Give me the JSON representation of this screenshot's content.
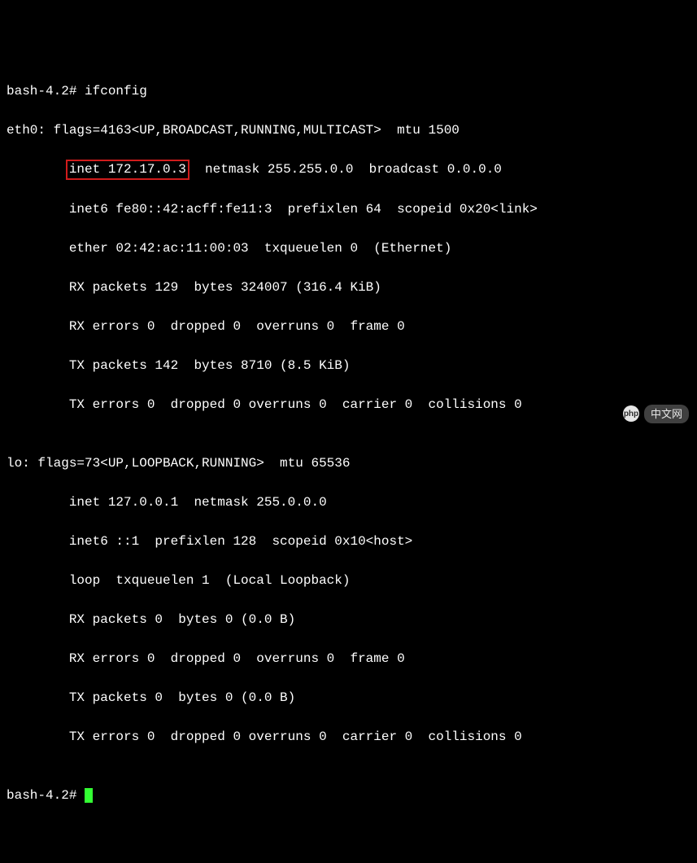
{
  "prompt1": "bash-4.2# ",
  "command": "ifconfig",
  "eth0": {
    "header": "eth0: flags=4163<UP,BROADCAST,RUNNING,MULTICAST>  mtu 1500",
    "inet_highlight": "inet 172.17.0.3",
    "inet_rest": "  netmask 255.255.0.0  broadcast 0.0.0.0",
    "inet6": "        inet6 fe80::42:acff:fe11:3  prefixlen 64  scopeid 0x20<link>",
    "ether": "        ether 02:42:ac:11:00:03  txqueuelen 0  (Ethernet)",
    "rx_packets": "        RX packets 129  bytes 324007 (316.4 KiB)",
    "rx_errors": "        RX errors 0  dropped 0  overruns 0  frame 0",
    "tx_packets": "        TX packets 142  bytes 8710 (8.5 KiB)",
    "tx_errors": "        TX errors 0  dropped 0 overruns 0  carrier 0  collisions 0"
  },
  "blank": "",
  "lo": {
    "header": "lo: flags=73<UP,LOOPBACK,RUNNING>  mtu 65536",
    "inet": "        inet 127.0.0.1  netmask 255.0.0.0",
    "inet6": "        inet6 ::1  prefixlen 128  scopeid 0x10<host>",
    "loop": "        loop  txqueuelen 1  (Local Loopback)",
    "rx_packets": "        RX packets 0  bytes 0 (0.0 B)",
    "rx_errors": "        RX errors 0  dropped 0  overruns 0  frame 0",
    "tx_packets": "        TX packets 0  bytes 0 (0.0 B)",
    "tx_errors": "        TX errors 0  dropped 0 overruns 0  carrier 0  collisions 0"
  },
  "prompt2": "bash-4.2# ",
  "watermark": {
    "logo": "php",
    "text": "中文网"
  }
}
